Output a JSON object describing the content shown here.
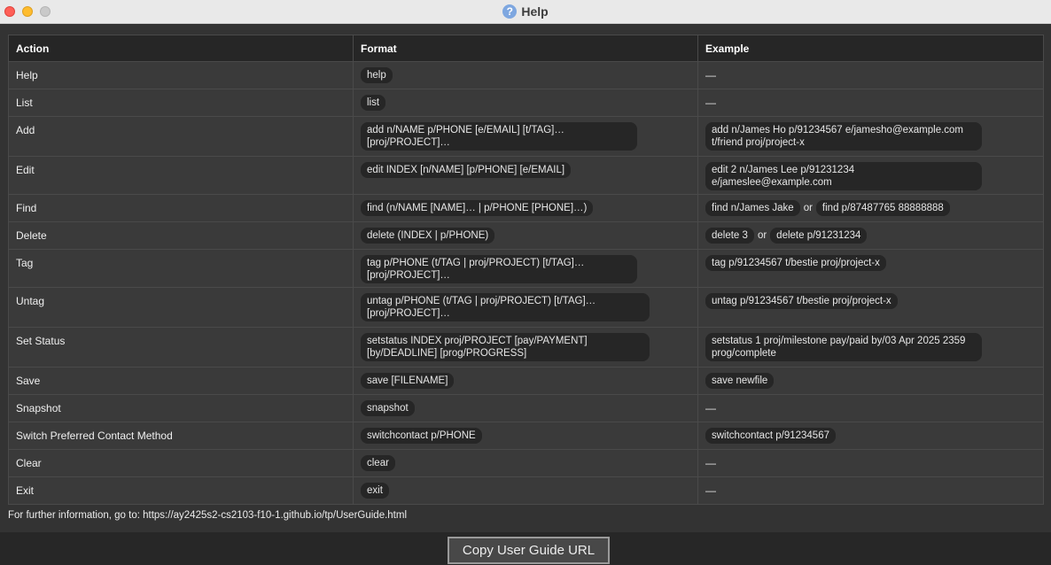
{
  "window": {
    "title": "Help",
    "help_icon_glyph": "?"
  },
  "table": {
    "headers": [
      "Action",
      "Format",
      "Example"
    ],
    "rows": [
      {
        "action": "Help",
        "format": "help",
        "examples": []
      },
      {
        "action": "List",
        "format": "list",
        "examples": []
      },
      {
        "action": "Add",
        "format": "add n/NAME p/PHONE [e/EMAIL] [t/TAG]… [proj/PROJECT]…",
        "examples": [
          "add n/James Ho p/91234567 e/jamesho@example.com t/friend proj/project-x"
        ]
      },
      {
        "action": "Edit",
        "format": "edit INDEX [n/NAME] [p/PHONE] [e/EMAIL]",
        "examples": [
          "edit 2 n/James Lee p/91231234 e/jameslee@example.com"
        ]
      },
      {
        "action": "Find",
        "format": "find (n/NAME [NAME]… | p/PHONE [PHONE]…)",
        "examples": [
          "find n/James Jake",
          "find p/87487765 88888888"
        ]
      },
      {
        "action": "Delete",
        "format": "delete (INDEX  |  p/PHONE)",
        "examples": [
          "delete 3",
          "delete p/91231234"
        ]
      },
      {
        "action": "Tag",
        "format": "tag p/PHONE (t/TAG  |  proj/PROJECT) [t/TAG]… [proj/PROJECT]…",
        "examples": [
          "tag p/91234567 t/bestie proj/project-x"
        ]
      },
      {
        "action": "Untag",
        "format": "untag p/PHONE (t/TAG  |  proj/PROJECT) [t/TAG]… [proj/PROJECT]…",
        "examples": [
          "untag p/91234567 t/bestie proj/project-x"
        ]
      },
      {
        "action": "Set Status",
        "format": "setstatus INDEX proj/PROJECT [pay/PAYMENT] [by/DEADLINE] [prog/PROGRESS]",
        "examples": [
          "setstatus 1 proj/milestone pay/paid by/03 Apr 2025 2359 prog/complete"
        ]
      },
      {
        "action": "Save",
        "format": "save [FILENAME]",
        "examples": [
          "save newfile"
        ]
      },
      {
        "action": "Snapshot",
        "format": "snapshot",
        "examples": []
      },
      {
        "action": "Switch Preferred Contact Method",
        "format": "switchcontact p/PHONE",
        "examples": [
          "switchcontact p/91234567"
        ]
      },
      {
        "action": "Clear",
        "format": "clear",
        "examples": []
      },
      {
        "action": "Exit",
        "format": "exit",
        "examples": []
      }
    ],
    "or_label": "or",
    "empty_example": "—"
  },
  "footer": {
    "info_text": "For further information, go to: https://ay2425s2-cs2103-f10-1.github.io/tp/UserGuide.html",
    "copy_button_label": "Copy User Guide URL"
  },
  "colors": {
    "background": "#333333",
    "header_background": "#262626",
    "cell_background": "#3a3a3a",
    "pill_background": "#262626",
    "close": "#fe5f57",
    "minimize": "#febc2e",
    "zoom_disabled": "#c9c9c9"
  }
}
